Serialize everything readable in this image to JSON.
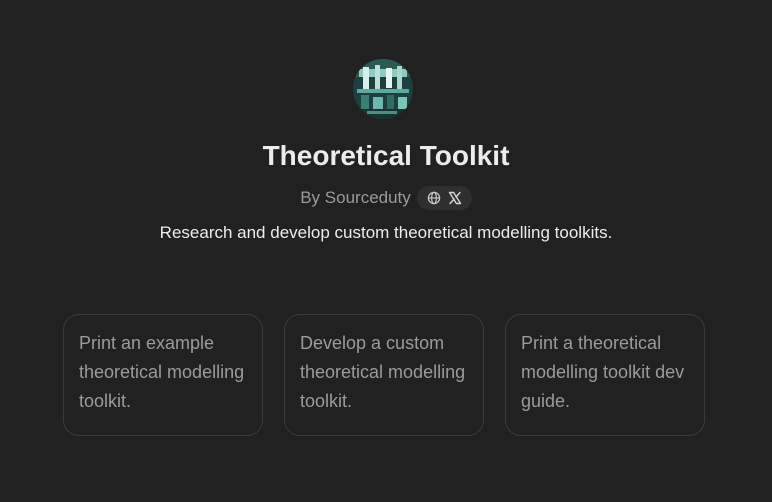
{
  "gpt": {
    "name": "Theoretical Toolkit",
    "author": "By Sourceduty",
    "description": "Research and develop custom theoretical modelling toolkits.",
    "social_icons": [
      "globe-icon",
      "x-logo-icon"
    ]
  },
  "conversation_starters": [
    "Print an example theoretical modelling toolkit.",
    "Develop a custom theoretical modelling toolkit.",
    "Print a theoretical modelling toolkit dev guide."
  ],
  "colors": {
    "background": "#212121",
    "title": "#ececec",
    "muted": "#9b9b9b",
    "card_border": "#3a3a3a",
    "pill_bg": "#2f2f2f"
  }
}
